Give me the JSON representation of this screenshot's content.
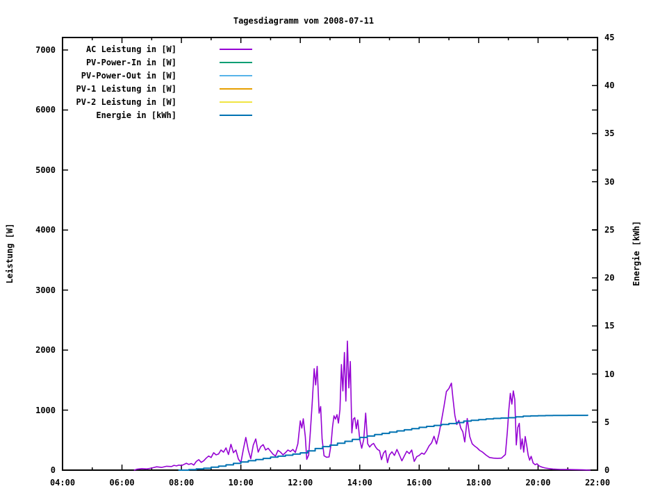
{
  "title": "Tagesdiagramm vom 2008-07-11",
  "axes": {
    "x": {
      "tick_labels": [
        "04:00",
        "06:00",
        "08:00",
        "10:00",
        "12:00",
        "14:00",
        "16:00",
        "18:00",
        "20:00",
        "22:00"
      ],
      "major_every_minutes": 120,
      "minor_every_minutes": 60,
      "range_minutes": [
        240,
        1320
      ]
    },
    "y1": {
      "label": "Leistung [W]",
      "ticks": [
        0,
        1000,
        2000,
        3000,
        4000,
        5000,
        6000,
        7000
      ],
      "range": [
        0,
        7208
      ]
    },
    "y2": {
      "label": "Energie [kWh]",
      "ticks": [
        0,
        5,
        10,
        15,
        20,
        25,
        30,
        35,
        40,
        45
      ],
      "range": [
        0,
        45
      ]
    }
  },
  "legend": [
    {
      "label": "AC Leistung in [W]",
      "color": "#9400d3"
    },
    {
      "label": "PV-Power-In in [W]",
      "color": "#009e73"
    },
    {
      "label": "PV-Power-Out in [W]",
      "color": "#56b4e9"
    },
    {
      "label": "PV-1 Leistung in [W]",
      "color": "#e69f00"
    },
    {
      "label": "PV-2 Leistung in [W]",
      "color": "#f0e442"
    },
    {
      "label": "Energie in [kWh]",
      "color": "#0072b2"
    }
  ],
  "chart_data": {
    "type": "line",
    "title": "Tagesdiagramm vom 2008-07-11",
    "xlabel": "",
    "x_tick_labels": [
      "04:00",
      "06:00",
      "08:00",
      "10:00",
      "12:00",
      "14:00",
      "16:00",
      "18:00",
      "20:00",
      "22:00"
    ],
    "x_range": [
      "04:00",
      "22:00"
    ],
    "grid": false,
    "legend_position": "top-left-inside",
    "y1_label": "Leistung [W]",
    "y1_range": [
      0,
      7208
    ],
    "y2_label": "Energie [kWh]",
    "y2_range": [
      0,
      45
    ],
    "series": [
      {
        "name": "AC Leistung in [W]",
        "color": "#9400d3",
        "axis": "y1",
        "style": "lines",
        "points": [
          [
            "06:25",
            0
          ],
          [
            "06:30",
            15
          ],
          [
            "06:40",
            25
          ],
          [
            "06:50",
            20
          ],
          [
            "07:00",
            35
          ],
          [
            "07:10",
            55
          ],
          [
            "07:20",
            45
          ],
          [
            "07:30",
            65
          ],
          [
            "07:40",
            60
          ],
          [
            "07:45",
            80
          ],
          [
            "07:50",
            70
          ],
          [
            "07:55",
            85
          ],
          [
            "08:00",
            75
          ],
          [
            "08:05",
            95
          ],
          [
            "08:10",
            115
          ],
          [
            "08:15",
            95
          ],
          [
            "08:20",
            110
          ],
          [
            "08:25",
            85
          ],
          [
            "08:30",
            145
          ],
          [
            "08:35",
            175
          ],
          [
            "08:40",
            130
          ],
          [
            "08:45",
            155
          ],
          [
            "08:50",
            200
          ],
          [
            "08:55",
            235
          ],
          [
            "09:00",
            210
          ],
          [
            "09:05",
            290
          ],
          [
            "09:10",
            255
          ],
          [
            "09:15",
            270
          ],
          [
            "09:20",
            335
          ],
          [
            "09:25",
            300
          ],
          [
            "09:30",
            370
          ],
          [
            "09:35",
            260
          ],
          [
            "09:40",
            430
          ],
          [
            "09:45",
            290
          ],
          [
            "09:50",
            335
          ],
          [
            "09:55",
            185
          ],
          [
            "10:00",
            125
          ],
          [
            "10:05",
            345
          ],
          [
            "10:10",
            545
          ],
          [
            "10:15",
            330
          ],
          [
            "10:20",
            190
          ],
          [
            "10:25",
            415
          ],
          [
            "10:30",
            520
          ],
          [
            "10:35",
            300
          ],
          [
            "10:40",
            390
          ],
          [
            "10:45",
            425
          ],
          [
            "10:50",
            335
          ],
          [
            "10:55",
            365
          ],
          [
            "11:00",
            315
          ],
          [
            "11:05",
            265
          ],
          [
            "11:10",
            235
          ],
          [
            "11:15",
            330
          ],
          [
            "11:20",
            300
          ],
          [
            "11:25",
            255
          ],
          [
            "11:30",
            290
          ],
          [
            "11:35",
            335
          ],
          [
            "11:40",
            310
          ],
          [
            "11:45",
            345
          ],
          [
            "11:50",
            295
          ],
          [
            "11:55",
            440
          ],
          [
            "12:00",
            820
          ],
          [
            "12:03",
            700
          ],
          [
            "12:06",
            855
          ],
          [
            "12:10",
            560
          ],
          [
            "12:13",
            180
          ],
          [
            "12:17",
            255
          ],
          [
            "12:20",
            610
          ],
          [
            "12:24",
            1110
          ],
          [
            "12:28",
            1690
          ],
          [
            "12:31",
            1420
          ],
          [
            "12:34",
            1730
          ],
          [
            "12:38",
            950
          ],
          [
            "12:41",
            1060
          ],
          [
            "12:44",
            520
          ],
          [
            "12:48",
            240
          ],
          [
            "12:53",
            215
          ],
          [
            "12:58",
            220
          ],
          [
            "13:02",
            420
          ],
          [
            "13:05",
            720
          ],
          [
            "13:08",
            905
          ],
          [
            "13:11",
            850
          ],
          [
            "13:14",
            925
          ],
          [
            "13:17",
            785
          ],
          [
            "13:20",
            1010
          ],
          [
            "13:23",
            1760
          ],
          [
            "13:26",
            1320
          ],
          [
            "13:29",
            1960
          ],
          [
            "13:32",
            1150
          ],
          [
            "13:35",
            2150
          ],
          [
            "13:38",
            1370
          ],
          [
            "13:41",
            1810
          ],
          [
            "13:44",
            620
          ],
          [
            "13:47",
            850
          ],
          [
            "13:50",
            875
          ],
          [
            "13:53",
            690
          ],
          [
            "13:56",
            835
          ],
          [
            "14:00",
            510
          ],
          [
            "14:04",
            365
          ],
          [
            "14:08",
            510
          ],
          [
            "14:12",
            950
          ],
          [
            "14:16",
            440
          ],
          [
            "14:20",
            385
          ],
          [
            "14:24",
            425
          ],
          [
            "14:28",
            445
          ],
          [
            "14:32",
            385
          ],
          [
            "14:36",
            345
          ],
          [
            "14:40",
            325
          ],
          [
            "14:44",
            175
          ],
          [
            "14:48",
            285
          ],
          [
            "14:52",
            325
          ],
          [
            "14:56",
            125
          ],
          [
            "15:00",
            255
          ],
          [
            "15:05",
            305
          ],
          [
            "15:10",
            245
          ],
          [
            "15:15",
            345
          ],
          [
            "15:20",
            255
          ],
          [
            "15:25",
            155
          ],
          [
            "15:30",
            235
          ],
          [
            "15:35",
            315
          ],
          [
            "15:40",
            275
          ],
          [
            "15:45",
            335
          ],
          [
            "15:50",
            145
          ],
          [
            "15:55",
            225
          ],
          [
            "16:00",
            245
          ],
          [
            "16:05",
            285
          ],
          [
            "16:10",
            265
          ],
          [
            "16:15",
            325
          ],
          [
            "16:20",
            405
          ],
          [
            "16:25",
            455
          ],
          [
            "16:30",
            565
          ],
          [
            "16:35",
            435
          ],
          [
            "16:40",
            610
          ],
          [
            "16:45",
            825
          ],
          [
            "16:50",
            1060
          ],
          [
            "16:55",
            1310
          ],
          [
            "17:00",
            1360
          ],
          [
            "17:05",
            1450
          ],
          [
            "17:08",
            1210
          ],
          [
            "17:12",
            910
          ],
          [
            "17:16",
            760
          ],
          [
            "17:20",
            830
          ],
          [
            "17:24",
            700
          ],
          [
            "17:28",
            640
          ],
          [
            "17:32",
            470
          ],
          [
            "17:37",
            860
          ],
          [
            "17:42",
            560
          ],
          [
            "17:47",
            440
          ],
          [
            "17:52",
            400
          ],
          [
            "17:57",
            370
          ],
          [
            "18:02",
            330
          ],
          [
            "18:08",
            300
          ],
          [
            "18:15",
            250
          ],
          [
            "18:22",
            210
          ],
          [
            "18:30",
            200
          ],
          [
            "18:38",
            195
          ],
          [
            "18:46",
            200
          ],
          [
            "18:54",
            260
          ],
          [
            "18:58",
            640
          ],
          [
            "19:01",
            1010
          ],
          [
            "19:04",
            1280
          ],
          [
            "19:07",
            1100
          ],
          [
            "19:10",
            1320
          ],
          [
            "19:13",
            1180
          ],
          [
            "19:16",
            420
          ],
          [
            "19:19",
            710
          ],
          [
            "19:22",
            780
          ],
          [
            "19:25",
            350
          ],
          [
            "19:28",
            520
          ],
          [
            "19:31",
            300
          ],
          [
            "19:34",
            560
          ],
          [
            "19:37",
            420
          ],
          [
            "19:40",
            250
          ],
          [
            "19:43",
            165
          ],
          [
            "19:46",
            230
          ],
          [
            "19:50",
            120
          ],
          [
            "19:54",
            90
          ],
          [
            "19:58",
            105
          ],
          [
            "20:02",
            70
          ],
          [
            "20:06",
            55
          ],
          [
            "20:10",
            45
          ],
          [
            "20:15",
            35
          ],
          [
            "20:20",
            28
          ],
          [
            "20:30",
            18
          ],
          [
            "20:45",
            12
          ],
          [
            "21:00",
            10
          ],
          [
            "21:15",
            8
          ],
          [
            "21:30",
            5
          ],
          [
            "21:45",
            0
          ]
        ]
      },
      {
        "name": "PV-Power-In in [W]",
        "color": "#009e73",
        "axis": "y1",
        "style": "lines",
        "points": []
      },
      {
        "name": "PV-Power-Out in [W]",
        "color": "#56b4e9",
        "axis": "y1",
        "style": "lines",
        "points": []
      },
      {
        "name": "PV-1 Leistung in [W]",
        "color": "#e69f00",
        "axis": "y1",
        "style": "lines",
        "points": []
      },
      {
        "name": "PV-2 Leistung in [W]",
        "color": "#f0e442",
        "axis": "y1",
        "style": "lines",
        "points": []
      },
      {
        "name": "Energie in [kWh]",
        "color": "#0072b2",
        "axis": "y2",
        "style": "steps",
        "points": [
          [
            "07:55",
            0.0
          ],
          [
            "08:15",
            0.06
          ],
          [
            "08:30",
            0.12
          ],
          [
            "08:45",
            0.2
          ],
          [
            "09:00",
            0.3
          ],
          [
            "09:15",
            0.42
          ],
          [
            "09:30",
            0.55
          ],
          [
            "09:45",
            0.7
          ],
          [
            "10:00",
            0.85
          ],
          [
            "10:15",
            0.98
          ],
          [
            "10:30",
            1.1
          ],
          [
            "10:45",
            1.22
          ],
          [
            "11:00",
            1.35
          ],
          [
            "11:15",
            1.45
          ],
          [
            "11:30",
            1.55
          ],
          [
            "11:45",
            1.67
          ],
          [
            "12:00",
            1.8
          ],
          [
            "12:15",
            2.0
          ],
          [
            "12:30",
            2.25
          ],
          [
            "12:45",
            2.45
          ],
          [
            "13:00",
            2.6
          ],
          [
            "13:15",
            2.8
          ],
          [
            "13:30",
            3.0
          ],
          [
            "13:45",
            3.2
          ],
          [
            "14:00",
            3.4
          ],
          [
            "14:15",
            3.55
          ],
          [
            "14:30",
            3.7
          ],
          [
            "14:45",
            3.82
          ],
          [
            "15:00",
            3.95
          ],
          [
            "15:15",
            4.08
          ],
          [
            "15:30",
            4.2
          ],
          [
            "15:45",
            4.32
          ],
          [
            "16:00",
            4.45
          ],
          [
            "16:15",
            4.55
          ],
          [
            "16:30",
            4.65
          ],
          [
            "16:45",
            4.75
          ],
          [
            "17:00",
            4.85
          ],
          [
            "17:15",
            4.95
          ],
          [
            "17:30",
            5.1
          ],
          [
            "17:45",
            5.18
          ],
          [
            "18:00",
            5.25
          ],
          [
            "18:15",
            5.32
          ],
          [
            "18:30",
            5.38
          ],
          [
            "18:45",
            5.42
          ],
          [
            "19:00",
            5.45
          ],
          [
            "19:15",
            5.55
          ],
          [
            "19:30",
            5.62
          ],
          [
            "19:45",
            5.64
          ],
          [
            "20:00",
            5.66
          ],
          [
            "20:15",
            5.68
          ],
          [
            "20:30",
            5.69
          ],
          [
            "21:00",
            5.7
          ],
          [
            "21:40",
            5.71
          ]
        ]
      }
    ]
  }
}
